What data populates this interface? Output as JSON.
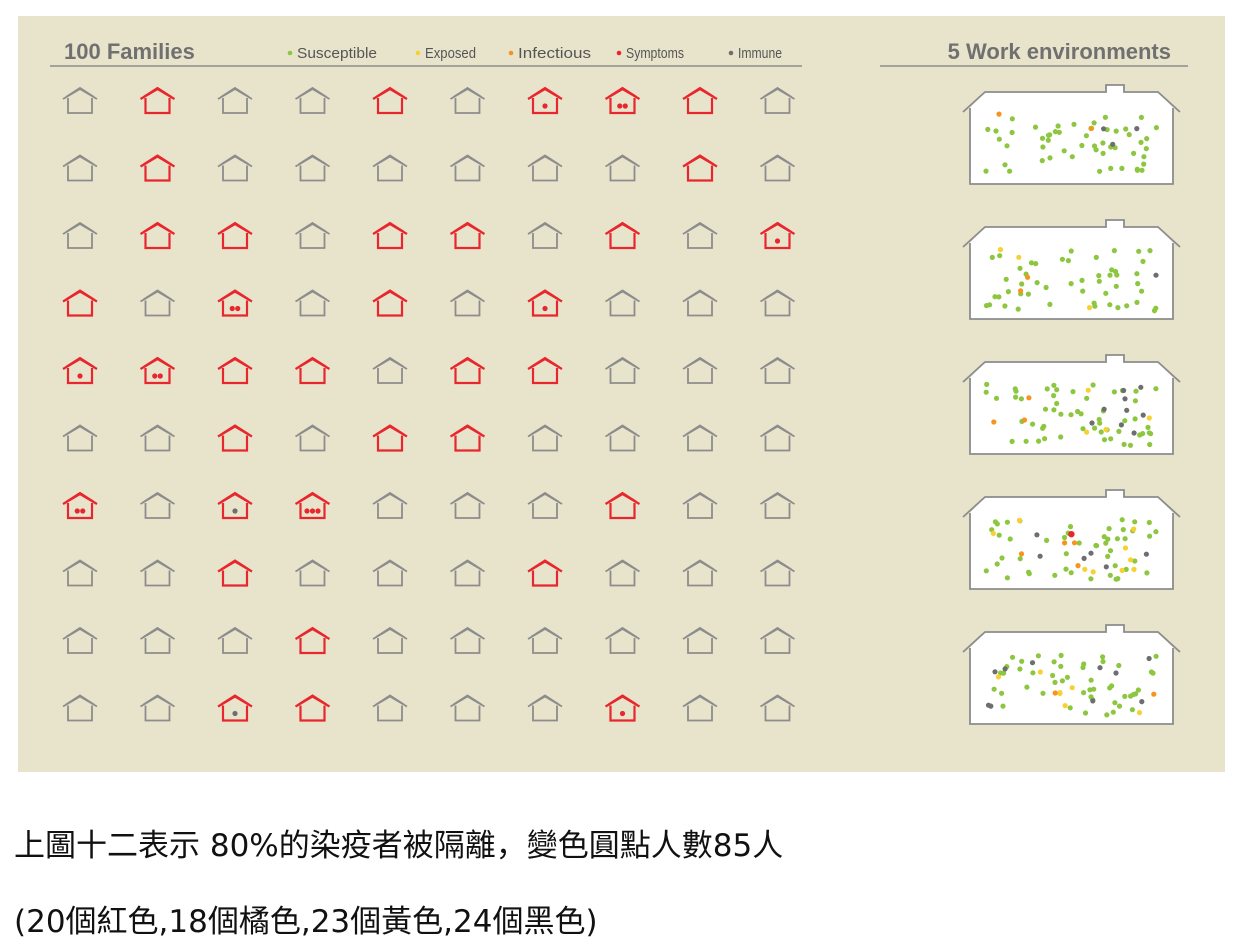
{
  "figure": {
    "families_title": "100 Families",
    "work_title": "5 Work environments",
    "legend": [
      {
        "label": "Susceptible",
        "color": "#8dc63f"
      },
      {
        "label": "Exposed",
        "color": "#f7d131"
      },
      {
        "label": "Infectious",
        "color": "#f7941d"
      },
      {
        "label": "Symptoms",
        "color": "#e8262d"
      },
      {
        "label": "Immune",
        "color": "#6d6e71"
      }
    ],
    "colors": {
      "house_plain": "#8c8c8c",
      "house_infected": "#e8262d",
      "panel_bg": "#e8e4cc",
      "rule": "#8c8c8c",
      "title": "#707070"
    },
    "houses": [
      [
        "p",
        "r",
        "p",
        "p",
        "r",
        "p",
        "r:S",
        "r:SS",
        "r",
        "p"
      ],
      [
        "p",
        "r",
        "p",
        "p",
        "p",
        "p",
        "p",
        "p",
        "r",
        "p"
      ],
      [
        "p",
        "r",
        "r",
        "p",
        "r",
        "r",
        "p",
        "r",
        "p",
        "r:S"
      ],
      [
        "r",
        "p",
        "r:SS",
        "p",
        "r",
        "p",
        "r:S",
        "p",
        "p",
        "p"
      ],
      [
        "r:S",
        "r:SS",
        "r",
        "r",
        "p",
        "r",
        "r",
        "p",
        "p",
        "p"
      ],
      [
        "p",
        "p",
        "r",
        "p",
        "r",
        "r",
        "p",
        "p",
        "p",
        "p"
      ],
      [
        "r:SS",
        "p",
        "r:I",
        "r:SSS",
        "p",
        "p",
        "p",
        "r",
        "p",
        "p"
      ],
      [
        "p",
        "p",
        "r",
        "p",
        "p",
        "p",
        "r",
        "p",
        "p",
        "p"
      ],
      [
        "p",
        "p",
        "p",
        "r",
        "p",
        "p",
        "p",
        "p",
        "p",
        "p"
      ],
      [
        "p",
        "p",
        "r:I",
        "r",
        "p",
        "p",
        "p",
        "r:S",
        "p",
        "p"
      ]
    ],
    "workplaces": [
      {
        "green": 52,
        "yellow": 0,
        "orange": 2,
        "red": 0,
        "gray": 3
      },
      {
        "green": 50,
        "yellow": 3,
        "orange": 2,
        "red": 0,
        "gray": 1
      },
      {
        "green": 55,
        "yellow": 4,
        "orange": 3,
        "red": 0,
        "gray": 9
      },
      {
        "green": 48,
        "yellow": 9,
        "orange": 4,
        "red": 1,
        "gray": 6
      },
      {
        "green": 48,
        "yellow": 7,
        "orange": 2,
        "red": 0,
        "gray": 10
      }
    ]
  },
  "caption": {
    "line1": "上圖十二表示 80%的染疫者被隔離，變色圓點人數85人",
    "line2": "(20個紅色,18個橘色,23個黃色,24個黑色)"
  }
}
